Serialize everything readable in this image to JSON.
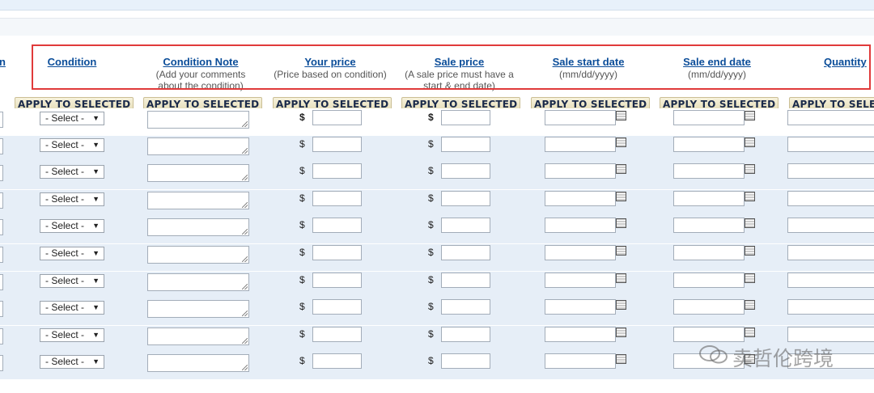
{
  "header": {
    "partial_left_label": "n",
    "columns": [
      {
        "key": "condition",
        "label": "Condition",
        "sub": ""
      },
      {
        "key": "condition_note",
        "label": "Condition Note",
        "sub": "(Add your comments about the condition)"
      },
      {
        "key": "your_price",
        "label": "Your price",
        "sub": "(Price based on condition)"
      },
      {
        "key": "sale_price",
        "label": "Sale price",
        "sub": "(A sale price must have a start & end date)"
      },
      {
        "key": "sale_start",
        "label": "Sale start date",
        "sub": "(mm/dd/yyyy)"
      },
      {
        "key": "sale_end",
        "label": "Sale end date",
        "sub": "(mm/dd/yyyy)"
      },
      {
        "key": "quantity",
        "label": "Quantity",
        "sub": ""
      }
    ],
    "apply_label": "APPLY TO SELECTED"
  },
  "select": {
    "value": "- Select -"
  },
  "currency_symbol": "$",
  "row_count": 10,
  "watermark": "卖哲伦跨境",
  "colors": {
    "link": "#0b4d99",
    "highlight": "#e03a3a",
    "row_bg": "#e6eef7"
  }
}
